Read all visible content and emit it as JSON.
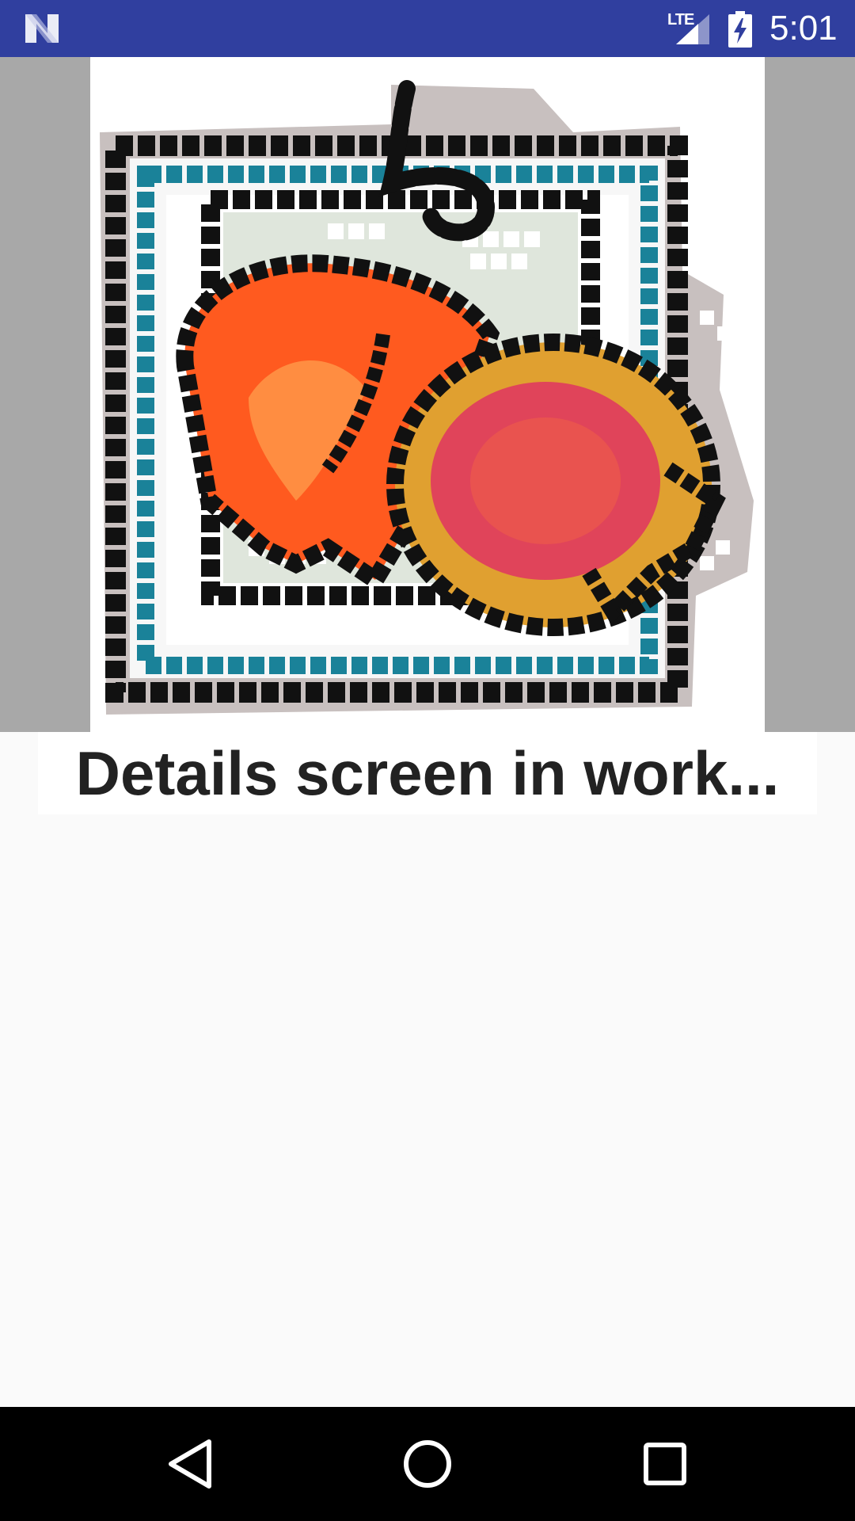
{
  "status_bar": {
    "network_label": "LTE",
    "time": "5:01",
    "notification_icon": "n-logo-icon",
    "signal_icon": "cell-signal-icon",
    "battery_icon": "battery-charging-icon"
  },
  "hero": {
    "image_description_icon": "mosaic-image"
  },
  "caption": {
    "text": "Details screen in work..."
  },
  "nav_bar": {
    "back_icon": "back-triangle-icon",
    "home_icon": "home-circle-icon",
    "recents_icon": "recents-square-icon"
  },
  "colors": {
    "status_bar": "#303f9f",
    "hero_background": "#a8a8a8",
    "page_background": "#fafafa",
    "caption_text": "#222222",
    "mosaic_black": "#111111",
    "mosaic_teal": "#1a8299",
    "mosaic_orange": "#ff5a1f",
    "mosaic_gold": "#e0a030",
    "mosaic_red": "#e0445a"
  }
}
